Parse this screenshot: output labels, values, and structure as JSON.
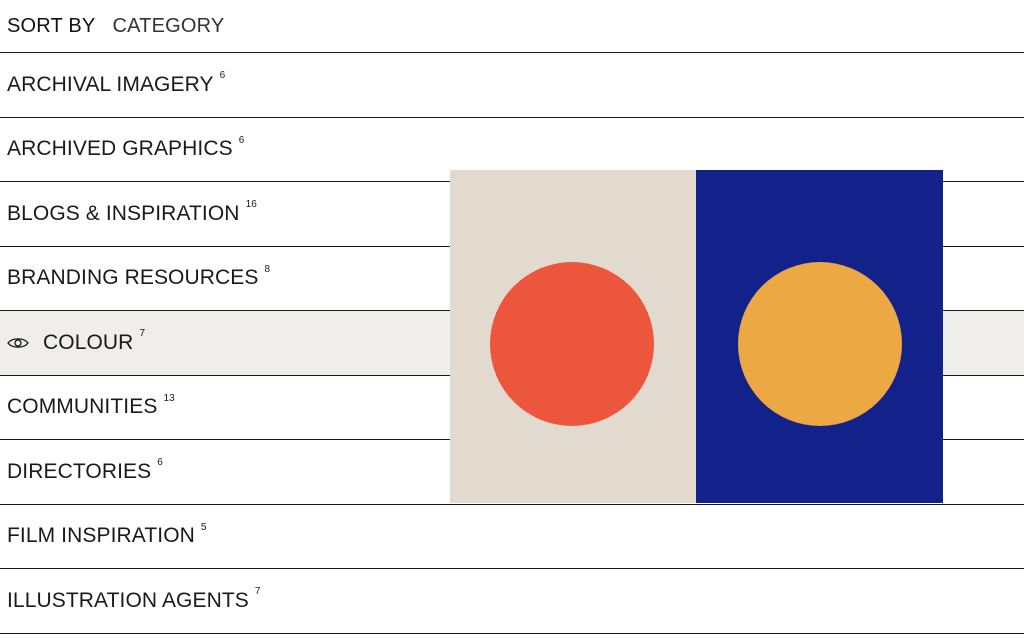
{
  "sort": {
    "label": "SORT BY",
    "value": "CATEGORY"
  },
  "categories": [
    {
      "label": "ARCHIVAL IMAGERY",
      "count": "6"
    },
    {
      "label": "ARCHIVED GRAPHICS",
      "count": "6"
    },
    {
      "label": "BLOGS & INSPIRATION",
      "count": "16"
    },
    {
      "label": "BRANDING RESOURCES",
      "count": "8"
    },
    {
      "label": "COLOUR",
      "count": "7",
      "active": true
    },
    {
      "label": "COMMUNITIES",
      "count": "13"
    },
    {
      "label": "DIRECTORIES",
      "count": "6"
    },
    {
      "label": "FILM INSPIRATION",
      "count": "5"
    },
    {
      "label": "ILLUSTRATION AGENTS",
      "count": "7"
    }
  ],
  "preview": {
    "left_bg": "#e2d9cf",
    "right_bg": "#13218a",
    "left_circle": "#eb563d",
    "right_circle": "#eca842"
  },
  "colors": {
    "active_row": "#efeeeb",
    "text": "#1a1a1a"
  }
}
